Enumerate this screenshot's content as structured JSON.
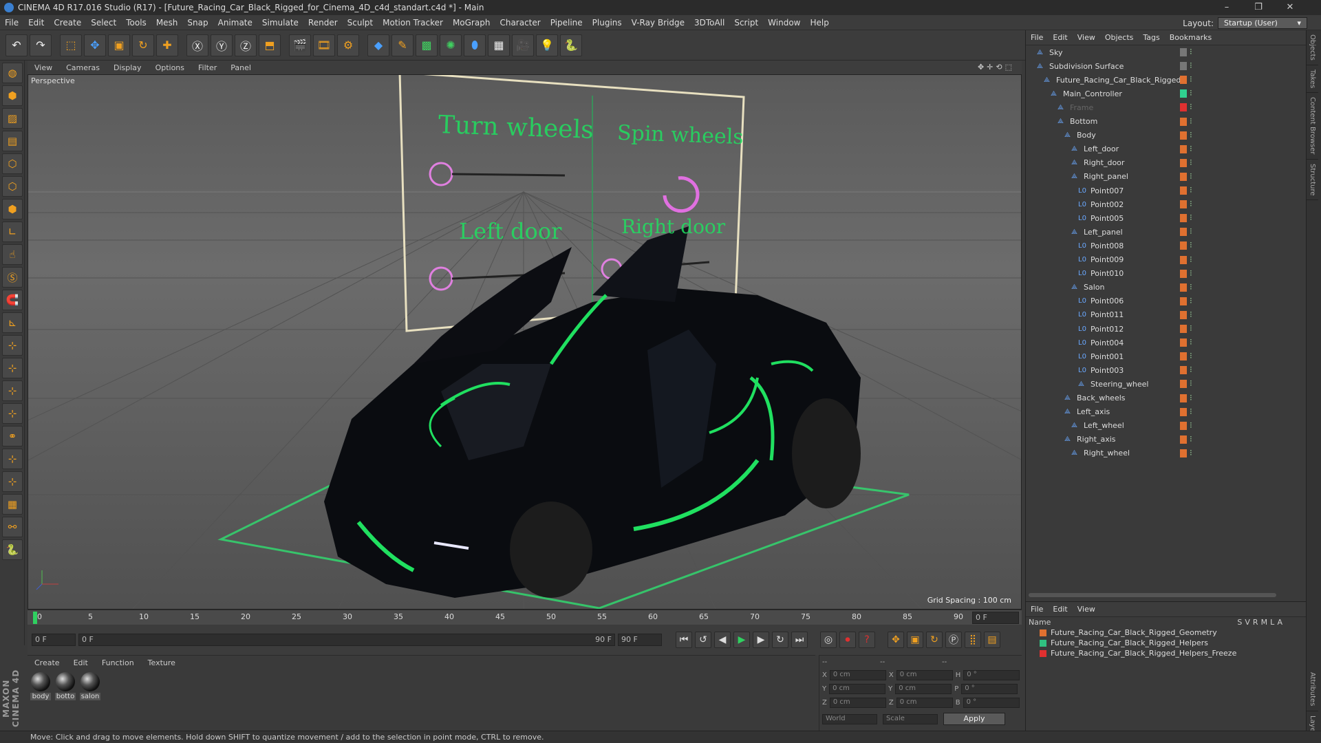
{
  "window": {
    "title": "CINEMA 4D R17.016 Studio (R17) - [Future_Racing_Car_Black_Rigged_for_Cinema_4D_c4d_standart.c4d *] - Main",
    "minimize": "–",
    "maximize": "❐",
    "close": "✕"
  },
  "menubar": {
    "items": [
      "File",
      "Edit",
      "Create",
      "Select",
      "Tools",
      "Mesh",
      "Snap",
      "Animate",
      "Simulate",
      "Render",
      "Sculpt",
      "Motion Tracker",
      "MoGraph",
      "Character",
      "Pipeline",
      "Plugins",
      "V-Ray Bridge",
      "3DToAll",
      "Script",
      "Window",
      "Help"
    ],
    "layout_label": "Layout:",
    "layout_value": "Startup (User)"
  },
  "viewport": {
    "menu": [
      "View",
      "Cameras",
      "Display",
      "Options",
      "Filter",
      "Panel"
    ],
    "label": "Perspective",
    "grid_spacing": "Grid Spacing : 100 cm",
    "controls": {
      "turn_wheels": "Turn wheels",
      "spin_wheels": "Spin wheels",
      "left_door": "Left door",
      "right_door": "Right door"
    }
  },
  "timeline": {
    "ticks": [
      "0",
      "5",
      "10",
      "15",
      "20",
      "25",
      "30",
      "35",
      "40",
      "45",
      "50",
      "55",
      "60",
      "65",
      "70",
      "75",
      "80",
      "85",
      "90"
    ],
    "end_field": "0 F",
    "start_field": "0 F",
    "range_start": "0 F",
    "range_end": "90 F",
    "max_field": "90 F"
  },
  "materials": {
    "menu": [
      "Create",
      "Edit",
      "Function",
      "Texture"
    ],
    "items": [
      "body",
      "botto",
      "salon"
    ]
  },
  "coords": {
    "rows": [
      {
        "a": "X",
        "av": "0 cm",
        "b": "X",
        "bv": "0 cm",
        "c": "H",
        "cv": "0 °"
      },
      {
        "a": "Y",
        "av": "0 cm",
        "b": "Y",
        "bv": "0 cm",
        "c": "P",
        "cv": "0 °"
      },
      {
        "a": "Z",
        "av": "0 cm",
        "b": "Z",
        "bv": "0 cm",
        "c": "B",
        "cv": "0 °"
      }
    ],
    "world": "World",
    "scale": "Scale",
    "apply": "Apply",
    "header_a": "--",
    "header_b": "--",
    "header_c": "--"
  },
  "objects": {
    "menu": [
      "File",
      "Edit",
      "View",
      "Objects",
      "Tags",
      "Bookmarks"
    ],
    "items": [
      {
        "name": "Sky",
        "indent": 0
      },
      {
        "name": "Subdivision Surface",
        "indent": 0
      },
      {
        "name": "Future_Racing_Car_Black_Rigged",
        "indent": 1
      },
      {
        "name": "Main_Controller",
        "indent": 2
      },
      {
        "name": "Frame",
        "indent": 3
      },
      {
        "name": "Bottom",
        "indent": 3
      },
      {
        "name": "Body",
        "indent": 4
      },
      {
        "name": "Left_door",
        "indent": 5
      },
      {
        "name": "Right_door",
        "indent": 5
      },
      {
        "name": "Right_panel",
        "indent": 5
      },
      {
        "name": "Point007",
        "indent": 6
      },
      {
        "name": "Point002",
        "indent": 6
      },
      {
        "name": "Point005",
        "indent": 6
      },
      {
        "name": "Left_panel",
        "indent": 5
      },
      {
        "name": "Point008",
        "indent": 6
      },
      {
        "name": "Point009",
        "indent": 6
      },
      {
        "name": "Point010",
        "indent": 6
      },
      {
        "name": "Salon",
        "indent": 5
      },
      {
        "name": "Point006",
        "indent": 6
      },
      {
        "name": "Point011",
        "indent": 6
      },
      {
        "name": "Point012",
        "indent": 6
      },
      {
        "name": "Point004",
        "indent": 6
      },
      {
        "name": "Point001",
        "indent": 6
      },
      {
        "name": "Point003",
        "indent": 6
      },
      {
        "name": "Steering_wheel",
        "indent": 6
      },
      {
        "name": "Back_wheels",
        "indent": 4
      },
      {
        "name": "Left_axis",
        "indent": 4
      },
      {
        "name": "Left_wheel",
        "indent": 5
      },
      {
        "name": "Right_axis",
        "indent": 4
      },
      {
        "name": "Right_wheel",
        "indent": 5
      }
    ]
  },
  "layers": {
    "menu": [
      "File",
      "Edit",
      "View"
    ],
    "header": {
      "name": "Name",
      "cols": [
        "S",
        "V",
        "R",
        "M",
        "L",
        "A"
      ]
    },
    "items": [
      {
        "name": "Future_Racing_Car_Black_Rigged_Geometry",
        "color": "#e07030"
      },
      {
        "name": "Future_Racing_Car_Black_Rigged_Helpers",
        "color": "#30c080"
      },
      {
        "name": "Future_Racing_Car_Black_Rigged_Helpers_Freeze",
        "color": "#e03030"
      }
    ]
  },
  "side_tabs": [
    "Objects",
    "Takes",
    "Content Browser",
    "Structure"
  ],
  "side_tabs_bottom": [
    "Attributes",
    "Layers"
  ],
  "status": "Move: Click and drag to move elements. Hold down SHIFT to quantize movement / add to the selection in point mode, CTRL to remove.",
  "maxon": "MAXON CINEMA 4D",
  "colors": {
    "accent": "#f0a020",
    "green": "#20e060",
    "panel": "#3a3a3a"
  }
}
